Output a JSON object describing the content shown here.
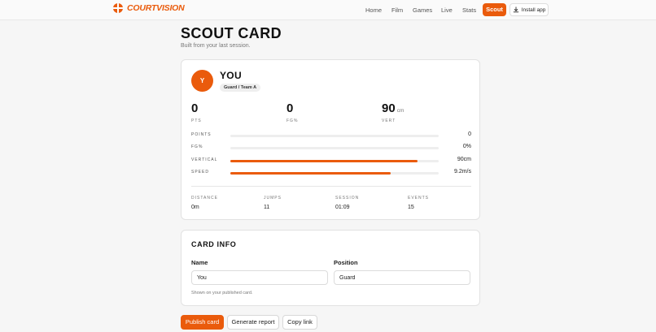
{
  "brand": {
    "name": "COURTVISION",
    "logo_icon": "basketball-icon",
    "accent": "#ea5b0c"
  },
  "nav": {
    "items": [
      {
        "label": "Home"
      },
      {
        "label": "Film"
      },
      {
        "label": "Games"
      },
      {
        "label": "Live"
      },
      {
        "label": "Stats"
      }
    ],
    "active_label": "Scout",
    "install_label": "Install app",
    "install_icon": "download-icon"
  },
  "page": {
    "title": "SCOUT CARD",
    "subtitle": "Built from your last session."
  },
  "player": {
    "initial": "Y",
    "name": "YOU",
    "role": "Guard / Team A"
  },
  "headline_stats": [
    {
      "value": "0",
      "unit": "",
      "label": "PTS"
    },
    {
      "value": "0",
      "unit": "",
      "label": "FG%"
    },
    {
      "value": "90",
      "unit": "cm",
      "label": "VERT"
    }
  ],
  "bars": [
    {
      "label": "POINTS",
      "value": "0",
      "fill": 0
    },
    {
      "label": "FG%",
      "value": "0%",
      "fill": 0
    },
    {
      "label": "VERTICAL",
      "value": "90cm",
      "fill": 0.9
    },
    {
      "label": "SPEED",
      "value": "9.2m/s",
      "fill": 0.77
    }
  ],
  "session_stats": [
    {
      "label": "DISTANCE",
      "value": "0m"
    },
    {
      "label": "JUMPS",
      "value": "11"
    },
    {
      "label": "SESSION",
      "value": "01:09"
    },
    {
      "label": "EVENTS",
      "value": "15"
    }
  ],
  "card_info": {
    "title": "CARD INFO",
    "name_label": "Name",
    "name_value": "You",
    "position_label": "Position",
    "position_value": "Guard",
    "hint": "Shown on your published card."
  },
  "actions": {
    "publish": "Publish card",
    "report": "Generate report",
    "copy": "Copy link"
  }
}
